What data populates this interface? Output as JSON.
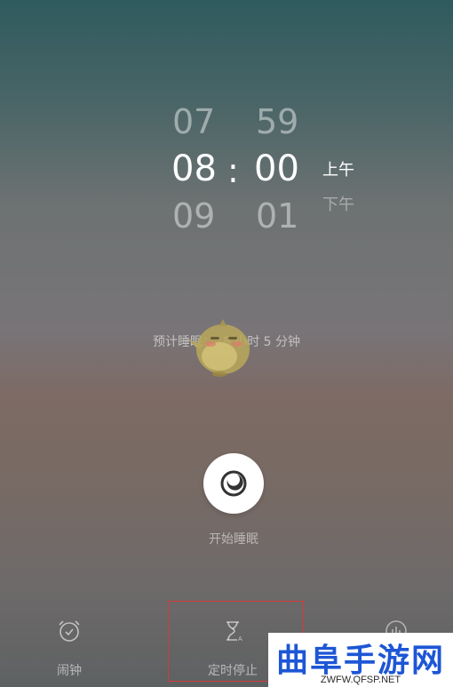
{
  "picker": {
    "hour_above": "07",
    "minute_above": "59",
    "hour_selected": "08",
    "colon": ":",
    "minute_selected": "00",
    "hour_below": "09",
    "minute_below": "01",
    "am": "上午",
    "pm": "下午"
  },
  "estimate": "预计睡眠：18 小时 5 分钟",
  "start_label": "开始睡眠",
  "tabs": [
    {
      "label": "闹钟",
      "icon": "alarm-clock-icon"
    },
    {
      "label": "定时停止",
      "icon": "hourglass-icon"
    },
    {
      "label": "",
      "icon": "stats-icon"
    }
  ],
  "watermark": {
    "title": "曲阜手游网",
    "url": "ZWFW.QFSP.NET"
  },
  "colors": {
    "highlight_border": "#d23b3b",
    "watermark_blue": "#1d56d6"
  }
}
